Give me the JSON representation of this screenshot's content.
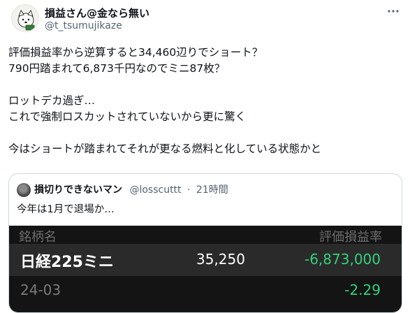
{
  "author": {
    "display_name": "損益さん@金なら無い",
    "handle": "@t_tsumujikaze"
  },
  "tweet": {
    "lines": [
      "評価損益率から逆算すると34,460辺りでショート？",
      "790円踏まれて6,873千円なのでミニ87枚？",
      "",
      "ロットデカ過ぎ…",
      "これで強制ロスカットされていないから更に驚く",
      "",
      "今はショートが踏まれてそれが更なる燃料と化している状態かと"
    ]
  },
  "quote": {
    "display_name": "損切りできないマン",
    "handle": "@losscuttt",
    "separator": "·",
    "time": "21時間",
    "text": "今年は1月で退場か…",
    "media": {
      "col_name": "銘柄名",
      "col_pl": "評価損益率",
      "stock_name": "日経225ミニ",
      "price": "35,250",
      "pl_amount": "-6,873,000",
      "contract": "24-03",
      "pl_rate": "-2.29"
    }
  },
  "icons": {
    "more": "more-icon",
    "avatar": "dog-avatar"
  },
  "colors": {
    "text": "#0f1419",
    "secondary": "#536471",
    "gain_loss_green": "#33d17a",
    "media_bg": "#141414"
  }
}
